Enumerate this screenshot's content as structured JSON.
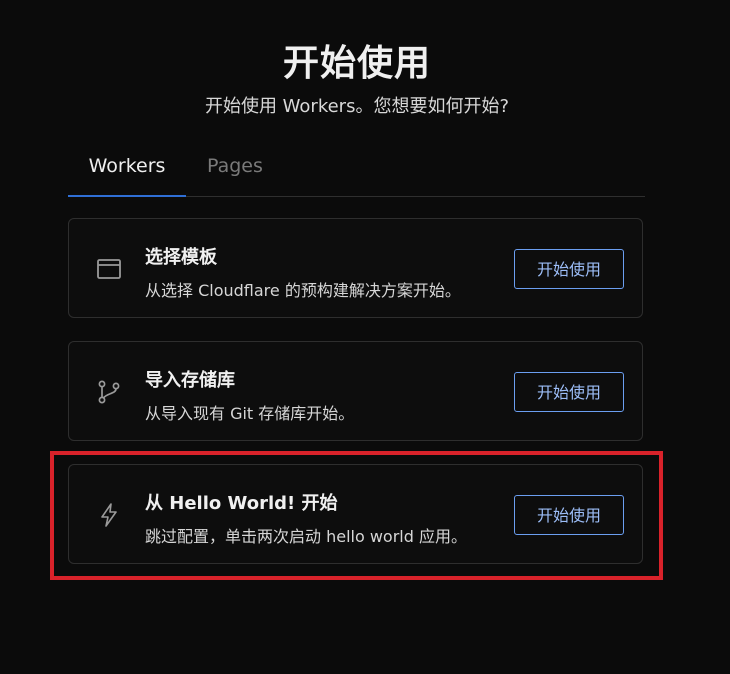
{
  "header": {
    "title": "开始使用",
    "subtitle": "开始使用 Workers。您想要如何开始?"
  },
  "tabs": [
    {
      "label": "Workers",
      "active": true
    },
    {
      "label": "Pages",
      "active": false
    }
  ],
  "options": [
    {
      "title": "选择模板",
      "description": "从选择 Cloudflare 的预构建解决方案开始。",
      "button_label": "开始使用",
      "icon": "browser-window-icon"
    },
    {
      "title": "导入存储库",
      "description": "从导入现有 Git 存储库开始。",
      "button_label": "开始使用",
      "icon": "git-branch-icon"
    },
    {
      "title": "从 Hello World! 开始",
      "description": "跳过配置，单击两次启动 hello world 应用。",
      "button_label": "开始使用",
      "icon": "lightning-bolt-icon",
      "highlighted": true
    }
  ],
  "colors": {
    "background": "#0b0b0b",
    "accent": "#2f6fd6",
    "button_border": "#6b9ef0",
    "highlight": "#d9222a"
  }
}
